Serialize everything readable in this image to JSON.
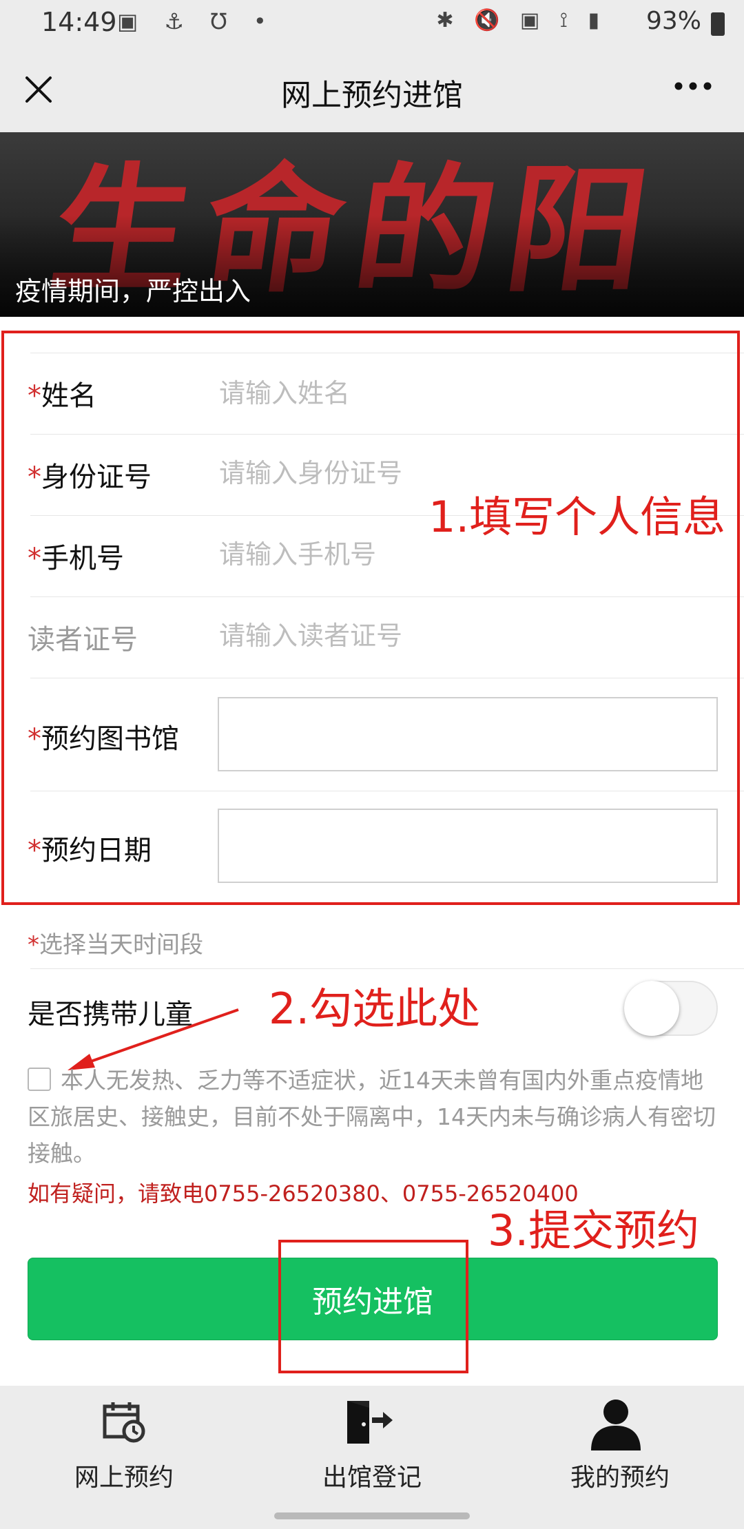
{
  "status_bar": {
    "time": "14:49",
    "left_icons": "▣ ⚓ Ʊ •",
    "right_icons": "✱ 🔇 ▣ ⟟ ▮",
    "battery": "93%"
  },
  "header": {
    "title": "网上预约进馆",
    "close_icon": "close-icon",
    "more_icon": "more-icon"
  },
  "banner": {
    "art_text": "生命的阳光",
    "caption": "疫情期间，严控出入"
  },
  "form": {
    "fields": [
      {
        "required": true,
        "label": "姓名",
        "placeholder": "请输入姓名"
      },
      {
        "required": true,
        "label": "身份证号",
        "placeholder": "请输入身份证号"
      },
      {
        "required": true,
        "label": "手机号",
        "placeholder": "请输入手机号"
      },
      {
        "required": false,
        "label": "读者证号",
        "placeholder": "请输入读者证号"
      },
      {
        "required": true,
        "label": "预约图书馆",
        "value": ""
      },
      {
        "required": true,
        "label": "预约日期",
        "value": ""
      }
    ],
    "required_mark": "*",
    "time_slot_label": "选择当天时间段",
    "child_label": "是否携带儿童",
    "child_toggle_on": false,
    "declaration": "本人无发热、乏力等不适症状，近14天未曾有国内外重点疫情地区旅居史、接触史，目前不处于隔离中，14天内未与确诊病人有密切接触。",
    "declaration_checked": false,
    "contact": "如有疑问，请致电0755-26520380、0755-26520400",
    "submit_label": "预约进馆"
  },
  "annotations": {
    "step1": "1.填写个人信息",
    "step2": "2.勾选此处",
    "step3": "3.提交预约",
    "color": "#e0201c"
  },
  "bottom_nav": {
    "items": [
      {
        "label": "网上预约",
        "icon": "calendar-clock-icon"
      },
      {
        "label": "出馆登记",
        "icon": "exit-door-icon"
      },
      {
        "label": "我的预约",
        "icon": "user-icon"
      }
    ]
  },
  "colors": {
    "primary_green": "#15c061",
    "required_red": "#d12f2f",
    "contact_red": "#c0201e"
  }
}
